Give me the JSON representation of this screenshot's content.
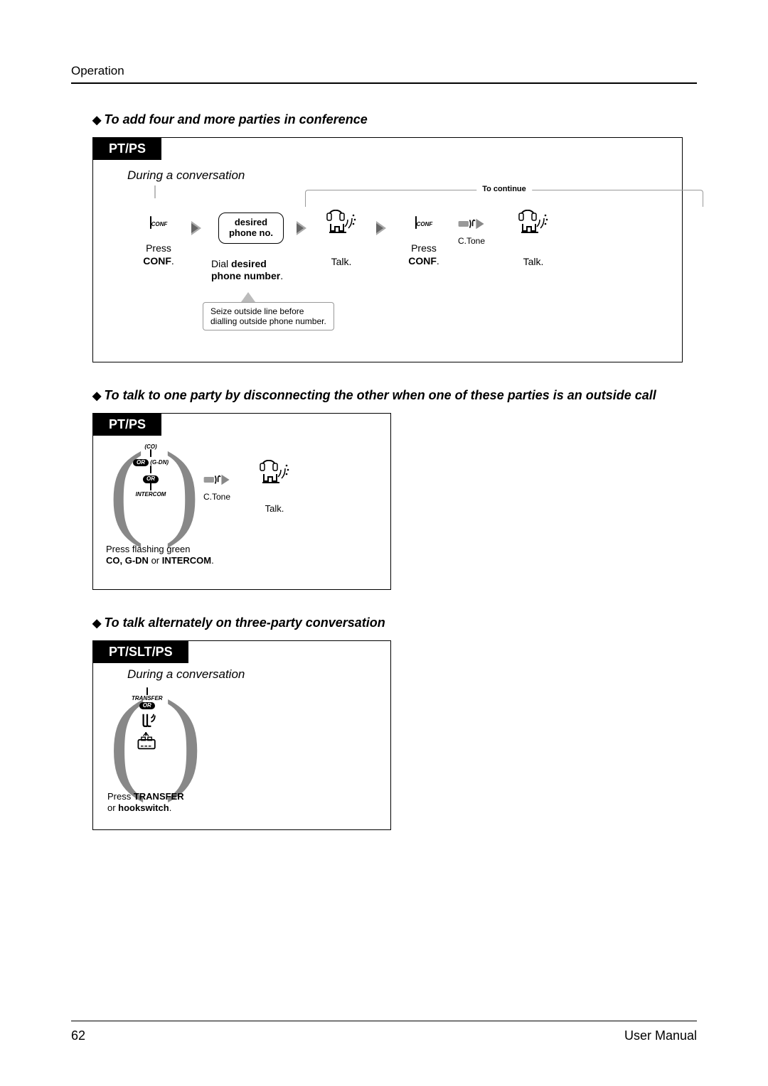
{
  "header": "Operation",
  "section1": {
    "title": "To add four and more parties in conference",
    "tab": "PT/PS",
    "context": "During a conversation",
    "toContinue": "To continue",
    "step1": {
      "key": "CONF",
      "caption_pre": "Press ",
      "caption_b": "CONF",
      "caption_post": "."
    },
    "step2": {
      "box_line1": "desired",
      "box_line2": "phone no.",
      "caption_pre": "Dial ",
      "caption_b1": "desired",
      "caption_br": "phone number",
      "caption_post": "."
    },
    "step3": {
      "caption": "Talk."
    },
    "step4": {
      "key": "CONF",
      "caption_pre": "Press ",
      "caption_b": "CONF",
      "caption_post": ".",
      "tone": "C.Tone"
    },
    "step5": {
      "caption": "Talk."
    },
    "note": "Seize outside line before\ndialling outside phone number."
  },
  "section2": {
    "title": "To talk to one party by disconnecting the other when one of these parties is an outside call",
    "tab": "PT/PS",
    "keys": {
      "k1": "(CO)",
      "k2": "(G-DN)",
      "k3": "INTERCOM",
      "or": "OR"
    },
    "tone": "C.Tone",
    "talk": "Talk.",
    "caption_pre": "Press flashing green",
    "caption_b": "CO, G-DN",
    "caption_mid": " or ",
    "caption_b2": "INTERCOM",
    "caption_post": "."
  },
  "section3": {
    "title": "To talk alternately on three-party conversation",
    "tab": "PT/SLT/PS",
    "context": "During a conversation",
    "key": "TRANSFER",
    "or": "OR",
    "caption_pre": "Press ",
    "caption_b": "TRANSFER",
    "caption_line2_pre": "or ",
    "caption_b2": "hookswitch",
    "caption_post": "."
  },
  "footer": {
    "page": "62",
    "doc": "User Manual"
  }
}
